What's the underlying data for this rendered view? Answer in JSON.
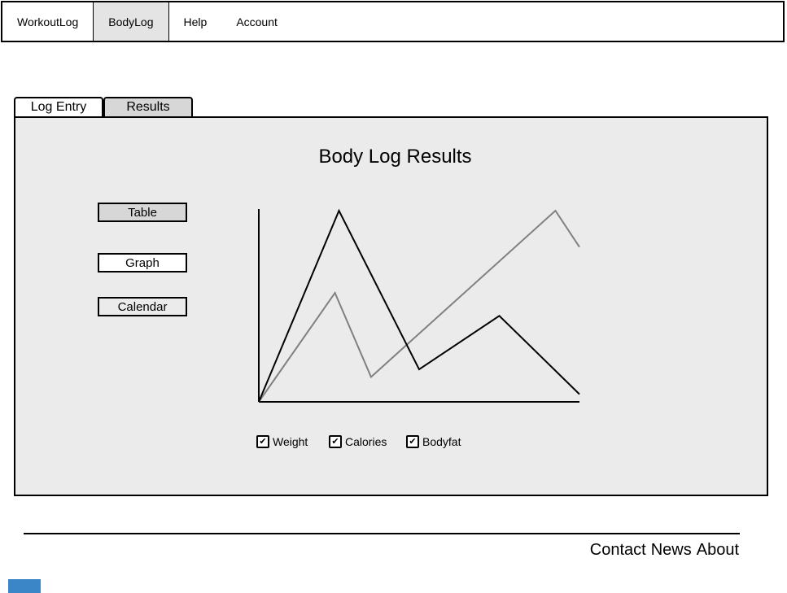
{
  "nav": {
    "items": [
      {
        "label": "WorkoutLog"
      },
      {
        "label": "BodyLog",
        "active": true
      },
      {
        "label": "Help"
      },
      {
        "label": "Account"
      }
    ]
  },
  "tabs": [
    {
      "label": "Log Entry"
    },
    {
      "label": "Results",
      "active": true
    }
  ],
  "panel": {
    "title": "Body Log Results"
  },
  "view_buttons": [
    {
      "label": "Table"
    },
    {
      "label": "Graph"
    },
    {
      "label": "Calendar"
    }
  ],
  "legend": [
    {
      "label": "Weight",
      "checked": true
    },
    {
      "label": "Calories",
      "checked": true
    },
    {
      "label": "Bodyfat",
      "checked": true
    }
  ],
  "chart_data": {
    "type": "line",
    "series": [
      {
        "values": [
          [
            0,
            0
          ],
          [
            1,
            100
          ],
          [
            2,
            17
          ],
          [
            3,
            45
          ],
          [
            4,
            4
          ]
        ],
        "color": "#000000"
      },
      {
        "values": [
          [
            0,
            0
          ],
          [
            0.95,
            57
          ],
          [
            1.4,
            13
          ],
          [
            3.7,
            100
          ],
          [
            4,
            81
          ]
        ],
        "color": "#808080"
      }
    ],
    "xlim": [
      0,
      4
    ],
    "ylim": [
      0,
      100
    ],
    "grid": false
  },
  "footer": {
    "links": [
      "Contact",
      "News",
      "About"
    ]
  },
  "colors": {
    "panel_bg": "#ebebeb",
    "active_bg": "#e4e4e4",
    "badge": "#3b86c6"
  }
}
